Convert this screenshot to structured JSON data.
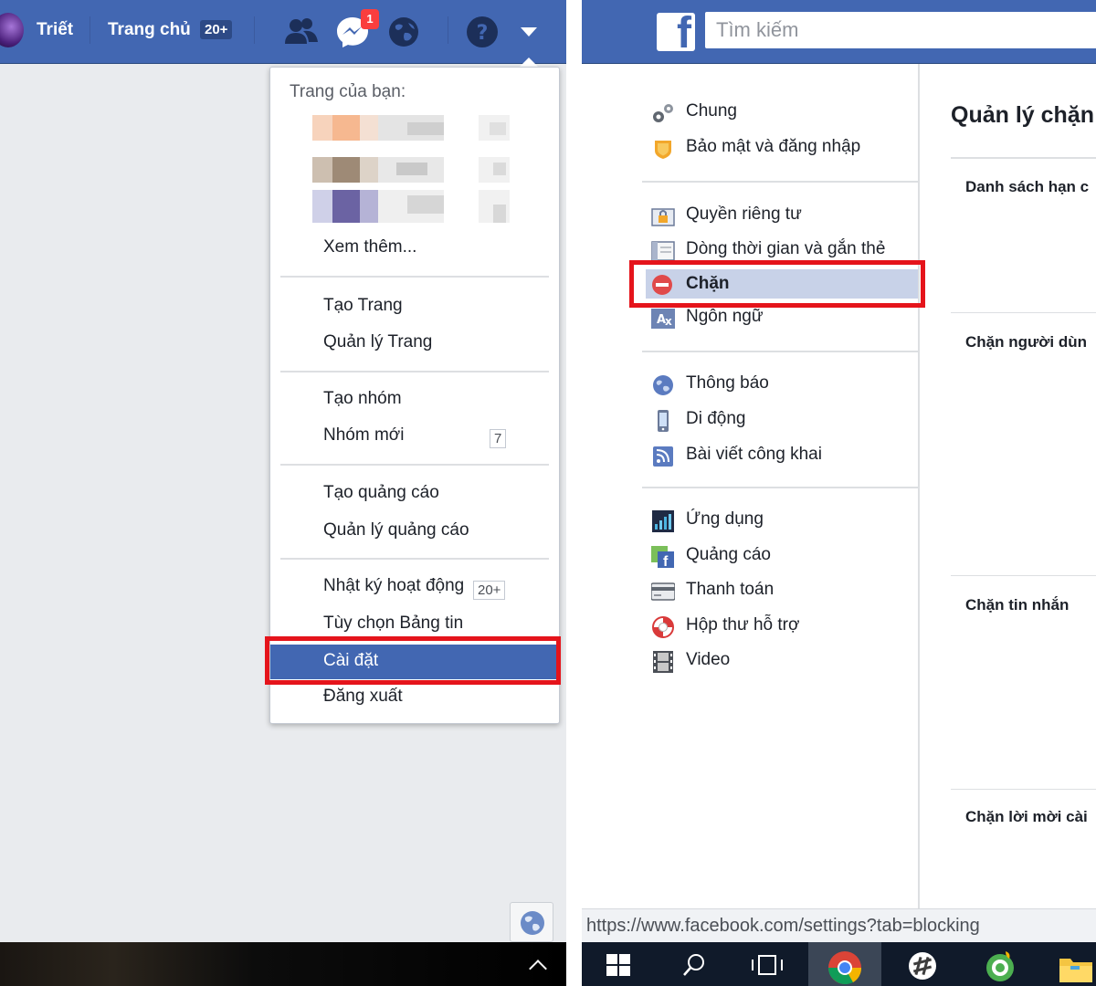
{
  "left": {
    "topbar": {
      "profile_name": "Triết",
      "home_label": "Trang chủ",
      "home_badge": "20+",
      "messages_badge": "1",
      "icons": [
        "friend-requests-icon",
        "messenger-icon",
        "notifications-globe-icon",
        "help-icon",
        "dropdown-arrow-icon"
      ]
    },
    "dropdown": {
      "header": "Trang của bạn:",
      "see_more": "Xem thêm...",
      "create_page": "Tạo Trang",
      "manage_page": "Quản lý Trang",
      "create_group": "Tạo nhóm",
      "new_groups": "Nhóm mới",
      "new_groups_count": "7",
      "create_ads": "Tạo quảng cáo",
      "manage_ads": "Quản lý quảng cáo",
      "activity_log": "Nhật ký hoạt động",
      "activity_log_count": "20+",
      "news_feed_prefs": "Tùy chọn Bảng tin",
      "settings": "Cài đặt",
      "logout": "Đăng xuất"
    }
  },
  "right": {
    "topbar": {
      "logo_letter": "f",
      "search_placeholder": "Tìm kiếm"
    },
    "nav": {
      "general": "Chung",
      "security": "Bảo mật và đăng nhập",
      "privacy": "Quyền riêng tư",
      "timeline": "Dòng thời gian và gắn thẻ",
      "blocking": "Chặn",
      "language": "Ngôn ngữ",
      "notifications": "Thông báo",
      "mobile": "Di động",
      "public_posts": "Bài viết công khai",
      "apps": "Ứng dụng",
      "ads": "Quảng cáo",
      "payments": "Thanh toán",
      "support_inbox": "Hộp thư hỗ trợ",
      "video": "Video"
    },
    "content": {
      "title": "Quản lý chặn",
      "restricted_list": "Danh sách hạn c",
      "block_users": "Chặn người dùn",
      "block_messages": "Chặn tin nhắn",
      "block_invites": "Chặn lời mời cài"
    },
    "status_url": "https://www.facebook.com/settings?tab=blocking",
    "taskbar_icons": [
      "windows-start-icon",
      "search-icon",
      "task-view-icon",
      "chrome-icon",
      "slack-icon",
      "coccoc-browser-icon",
      "file-explorer-icon"
    ]
  },
  "colors": {
    "facebook_blue": "#4267b2",
    "highlight_red": "#e5141b",
    "active_nav": "#c8d2e8",
    "notification_red": "#fa3e3e"
  }
}
